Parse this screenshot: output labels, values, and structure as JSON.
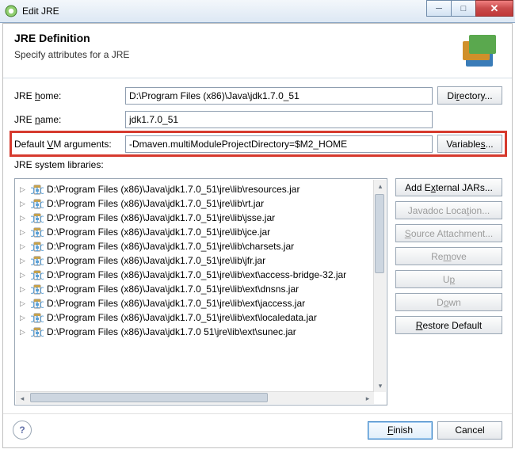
{
  "window": {
    "title": "Edit JRE"
  },
  "header": {
    "title": "JRE Definition",
    "subtitle": "Specify attributes for a JRE"
  },
  "form": {
    "home": {
      "label_pre": "JRE ",
      "label_mn": "h",
      "label_post": "ome:",
      "value": "D:\\Program Files (x86)\\Java\\jdk1.7.0_51",
      "button_pre": "Di",
      "button_mn": "r",
      "button_post": "ectory..."
    },
    "name": {
      "label_pre": "JRE ",
      "label_mn": "n",
      "label_post": "ame:",
      "value": "jdk1.7.0_51"
    },
    "vmargs": {
      "label_pre": "Default ",
      "label_mn": "V",
      "label_post": "M arguments:",
      "value": "-Dmaven.multiModuleProjectDirectory=$M2_HOME",
      "button_pre": "Variable",
      "button_mn": "s",
      "button_post": "..."
    }
  },
  "libs": {
    "label": "JRE system libraries:",
    "items": [
      "D:\\Program Files (x86)\\Java\\jdk1.7.0_51\\jre\\lib\\resources.jar",
      "D:\\Program Files (x86)\\Java\\jdk1.7.0_51\\jre\\lib\\rt.jar",
      "D:\\Program Files (x86)\\Java\\jdk1.7.0_51\\jre\\lib\\jsse.jar",
      "D:\\Program Files (x86)\\Java\\jdk1.7.0_51\\jre\\lib\\jce.jar",
      "D:\\Program Files (x86)\\Java\\jdk1.7.0_51\\jre\\lib\\charsets.jar",
      "D:\\Program Files (x86)\\Java\\jdk1.7.0_51\\jre\\lib\\jfr.jar",
      "D:\\Program Files (x86)\\Java\\jdk1.7.0_51\\jre\\lib\\ext\\access-bridge-32.jar",
      "D:\\Program Files (x86)\\Java\\jdk1.7.0_51\\jre\\lib\\ext\\dnsns.jar",
      "D:\\Program Files (x86)\\Java\\jdk1.7.0_51\\jre\\lib\\ext\\jaccess.jar",
      "D:\\Program Files (x86)\\Java\\jdk1.7.0_51\\jre\\lib\\ext\\localedata.jar",
      "D:\\Program Files (x86)\\Java\\jdk1.7.0 51\\jre\\lib\\ext\\sunec.jar"
    ]
  },
  "sidebuttons": {
    "add": {
      "pre": "Add E",
      "mn": "x",
      "post": "ternal JARs..."
    },
    "javadoc": {
      "pre": "Javadoc Loca",
      "mn": "t",
      "post": "ion..."
    },
    "source": {
      "pre": "",
      "mn": "S",
      "post": "ource Attachment..."
    },
    "remove": {
      "pre": "Re",
      "mn": "m",
      "post": "ove"
    },
    "up": {
      "pre": "U",
      "mn": "p",
      "post": ""
    },
    "down": {
      "pre": "D",
      "mn": "o",
      "post": "wn"
    },
    "restore": {
      "pre": "",
      "mn": "R",
      "post": "estore Default"
    }
  },
  "footer": {
    "finish_pre": "",
    "finish_mn": "F",
    "finish_post": "inish",
    "cancel": "Cancel"
  }
}
